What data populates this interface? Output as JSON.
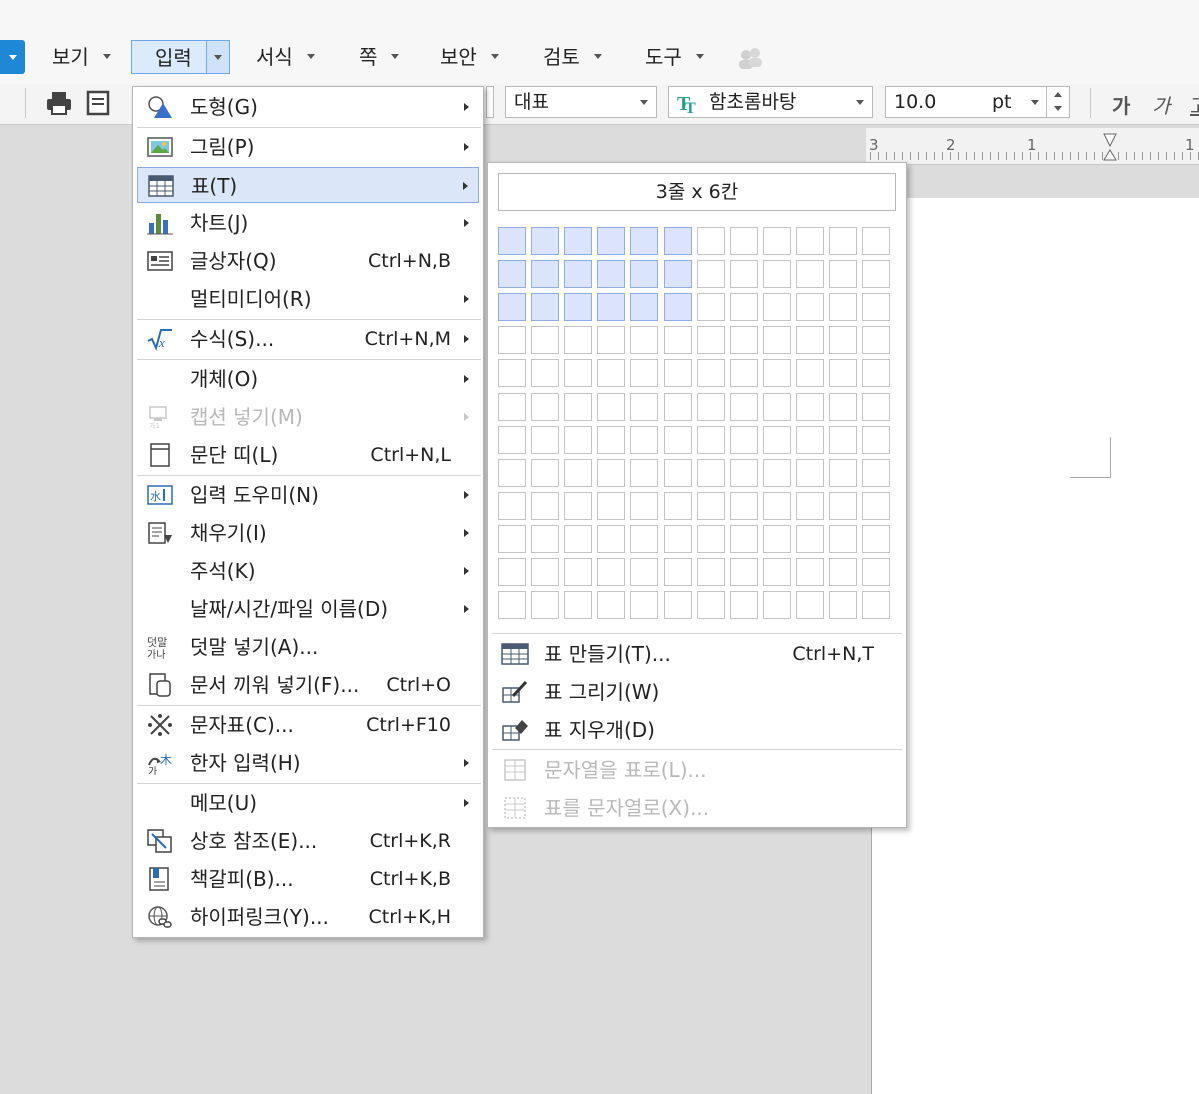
{
  "menubar": {
    "items": [
      {
        "label": "보기"
      },
      {
        "label": "입력"
      },
      {
        "label": "서식"
      },
      {
        "label": "쪽"
      },
      {
        "label": "보안"
      },
      {
        "label": "검토"
      },
      {
        "label": "도구"
      }
    ]
  },
  "toolbar": {
    "style_value": "대표",
    "font_value": "함초롬바탕",
    "size_value": "10.0",
    "size_unit": "pt",
    "bold_glyph": "가",
    "italic_glyph": "가",
    "underline_glyph": "고"
  },
  "ruler": {
    "labels": [
      "3",
      "2",
      "1",
      "1"
    ]
  },
  "input_menu": {
    "items": [
      {
        "label": "도형(G)",
        "shortcut": "",
        "submenu": true,
        "icon": "shape-icon"
      },
      {
        "label": "그림(P)",
        "shortcut": "",
        "submenu": true,
        "icon": "picture-icon"
      },
      {
        "label": "표(T)",
        "shortcut": "",
        "submenu": true,
        "icon": "table-icon"
      },
      {
        "label": "차트(J)",
        "shortcut": "",
        "submenu": true,
        "icon": "chart-icon"
      },
      {
        "label": "글상자(Q)",
        "shortcut": "Ctrl+N,B",
        "submenu": false,
        "icon": "textbox-icon"
      },
      {
        "label": "멀티미디어(R)",
        "shortcut": "",
        "submenu": true,
        "icon": ""
      },
      {
        "label": "수식(S)...",
        "shortcut": "Ctrl+N,M",
        "submenu": true,
        "icon": "formula-icon"
      },
      {
        "label": "개체(O)",
        "shortcut": "",
        "submenu": true,
        "icon": ""
      },
      {
        "label": "캡션 넣기(M)",
        "shortcut": "",
        "submenu": true,
        "icon": "caption-icon"
      },
      {
        "label": "문단 띠(L)",
        "shortcut": "Ctrl+N,L",
        "submenu": false,
        "icon": "paragraph-band-icon"
      },
      {
        "label": "입력 도우미(N)",
        "shortcut": "",
        "submenu": true,
        "icon": "input-helper-icon"
      },
      {
        "label": "채우기(I)",
        "shortcut": "",
        "submenu": true,
        "icon": "fill-icon"
      },
      {
        "label": "주석(K)",
        "shortcut": "",
        "submenu": true,
        "icon": ""
      },
      {
        "label": "날짜/시간/파일 이름(D)",
        "shortcut": "",
        "submenu": true,
        "icon": ""
      },
      {
        "label": "덧말 넣기(A)...",
        "shortcut": "",
        "submenu": false,
        "icon": "ruby-text-icon"
      },
      {
        "label": "문서 끼워 넣기(F)...",
        "shortcut": "Ctrl+O",
        "submenu": false,
        "icon": "insert-document-icon"
      },
      {
        "label": "문자표(C)...",
        "shortcut": "Ctrl+F10",
        "submenu": false,
        "icon": "symbol-icon"
      },
      {
        "label": "한자 입력(H)",
        "shortcut": "",
        "submenu": true,
        "icon": "hanja-icon"
      },
      {
        "label": "메모(U)",
        "shortcut": "",
        "submenu": true,
        "icon": ""
      },
      {
        "label": "상호 참조(E)...",
        "shortcut": "Ctrl+K,R",
        "submenu": false,
        "icon": "cross-reference-icon"
      },
      {
        "label": "책갈피(B)...",
        "shortcut": "Ctrl+K,B",
        "submenu": false,
        "icon": "bookmark-icon"
      },
      {
        "label": "하이퍼링크(Y)...",
        "shortcut": "Ctrl+K,H",
        "submenu": false,
        "icon": "hyperlink-icon"
      }
    ]
  },
  "table_submenu": {
    "grid_label": "3줄 x 6칸",
    "grid_rows": 12,
    "grid_cols": 12,
    "selected_rows": 3,
    "selected_cols": 6,
    "items": [
      {
        "label": "표 만들기(T)...",
        "shortcut": "Ctrl+N,T",
        "icon": "table-create-icon"
      },
      {
        "label": "표 그리기(W)",
        "shortcut": "",
        "icon": "table-draw-icon"
      },
      {
        "label": "표 지우개(D)",
        "shortcut": "",
        "icon": "table-eraser-icon"
      },
      {
        "label": "문자열을 표로(L)...",
        "shortcut": "",
        "icon": "text-to-table-icon"
      },
      {
        "label": "표를 문자열로(X)...",
        "shortcut": "",
        "icon": "table-to-text-icon"
      }
    ]
  },
  "colors": {
    "accent": "#1e88d6",
    "highlight": "#dbe6f9",
    "grid_selected": "#dbe4fa"
  }
}
